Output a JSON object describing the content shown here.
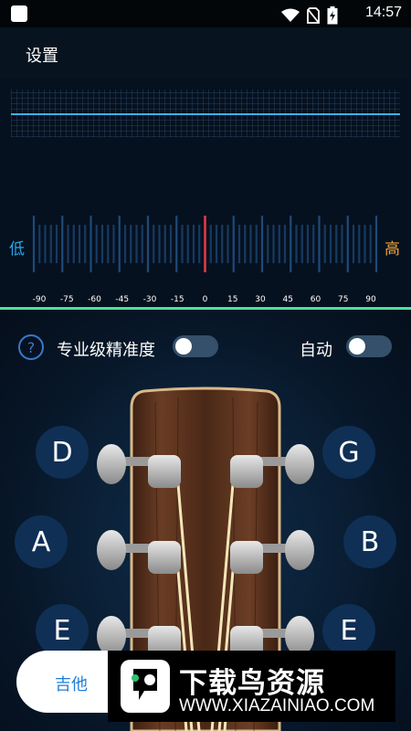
{
  "status_bar": {
    "time": "14:57",
    "icons": [
      "app-icon",
      "wifi-icon",
      "no-sim-icon",
      "battery-icon"
    ]
  },
  "header": {
    "title": "设置"
  },
  "meter": {
    "low_label": "低",
    "high_label": "高",
    "ticks": [
      "-90",
      "-75",
      "-60",
      "-45",
      "-30",
      "-15",
      "0",
      "15",
      "30",
      "45",
      "60",
      "75",
      "90"
    ],
    "needle_value": 0,
    "colors": {
      "needle": "#e53945",
      "low": "#2aa7e8",
      "high": "#e9a33a",
      "tuned_line": "#4de29a"
    }
  },
  "options": {
    "help_icon_glyph": "?",
    "pro_label": "专业级精准度",
    "pro_on": false,
    "auto_label": "自动",
    "auto_on": false
  },
  "strings": {
    "left": [
      "D",
      "A",
      "E"
    ],
    "right": [
      "G",
      "B",
      "E"
    ]
  },
  "instrument": {
    "label": "吉他"
  },
  "watermark": {
    "title": "下载鸟资源",
    "url": "WWW.XIAZAINIAO.COM"
  }
}
